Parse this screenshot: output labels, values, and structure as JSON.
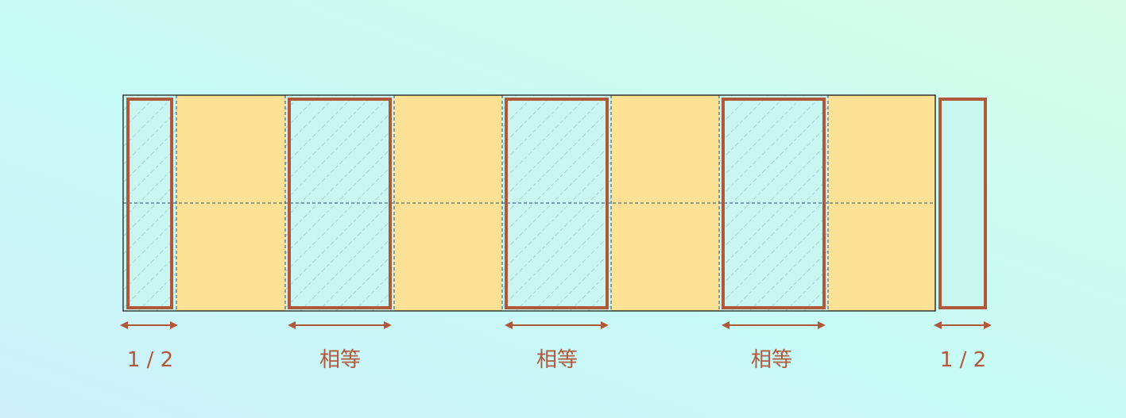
{
  "colors": {
    "background": "#c8f8f4",
    "container_fill": "#fde295",
    "item_fill": "#c9f6f0",
    "item_border": "#b1583a",
    "hatch": "#8fb8c0",
    "arrow": "#b1583a",
    "label": "#b1583a"
  },
  "labels": {
    "first_half": "1 / 2",
    "equal_1": "相等",
    "equal_2": "相等",
    "equal_3": "相等",
    "last_half": "1 / 2"
  }
}
